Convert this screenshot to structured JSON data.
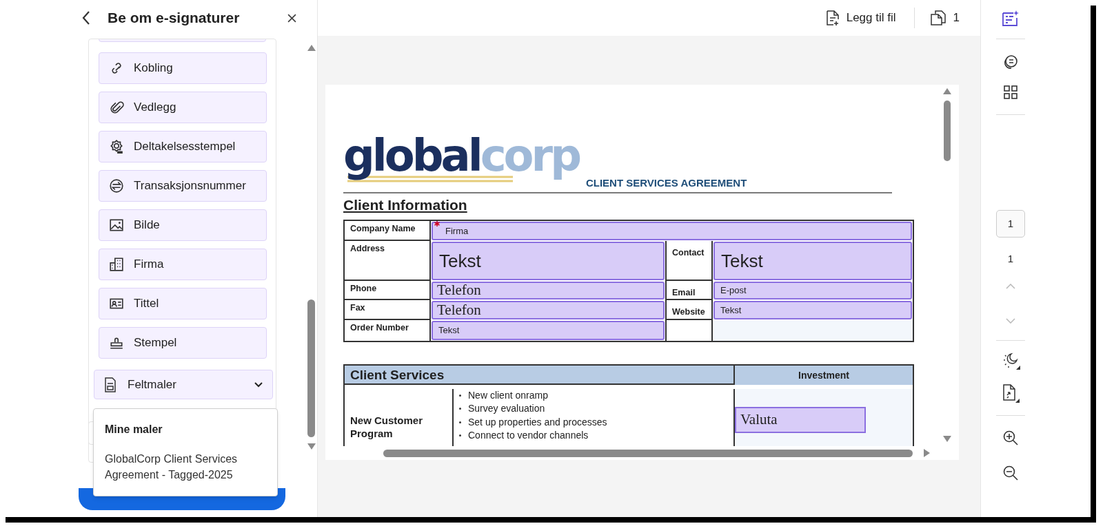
{
  "panel": {
    "title": "Be om e-signaturer",
    "items": [
      {
        "label": "Kobling"
      },
      {
        "label": "Vedlegg"
      },
      {
        "label": "Deltakelsesstempel"
      },
      {
        "label": "Transaksjonsnummer"
      },
      {
        "label": "Bilde"
      },
      {
        "label": "Firma"
      },
      {
        "label": "Tittel"
      },
      {
        "label": "Stempel"
      }
    ],
    "templates": {
      "label": "Feltmaler",
      "expanded": true
    },
    "menu": {
      "heading": "Mine maler",
      "items": [
        "GlobalCorp Client Services Agreement - Tagged-2025"
      ]
    }
  },
  "toolbar": {
    "add_file": "Legg til fil",
    "file_count": "1"
  },
  "document": {
    "logo": {
      "primary": "global",
      "secondary": "corp"
    },
    "doc_title": "CLIENT SERVICES AGREEMENT",
    "section": "Client Information",
    "company": {
      "label": "Company Name",
      "field": {
        "text": "Firma",
        "kind": "small",
        "required": true
      }
    },
    "left_rows": [
      {
        "label": "Address",
        "field": {
          "text": "Tekst",
          "kind": "large",
          "required": false
        }
      },
      {
        "label": "Phone",
        "field": {
          "text": "Telefon",
          "kind": "serif",
          "required": false
        }
      },
      {
        "label": "Fax",
        "field": {
          "text": "Telefon",
          "kind": "serif",
          "required": false
        }
      },
      {
        "label": "Order Number",
        "field": {
          "text": "Tekst",
          "kind": "small",
          "required": false
        }
      }
    ],
    "right_rows": [
      {
        "label": "Contact",
        "field": {
          "text": "Tekst",
          "kind": "large",
          "required": false
        }
      },
      {
        "label": "Email",
        "field": {
          "text": "E-post",
          "kind": "small",
          "required": false
        }
      },
      {
        "label": "Website",
        "field": {
          "text": "Tekst",
          "kind": "small",
          "required": false
        }
      }
    ],
    "services": {
      "heading": "Client Services",
      "investment": "Investment",
      "program": "New Customer Program",
      "bullets": [
        "New client onramp",
        "Survey evaluation",
        "Set up properties and processes",
        "Connect to vendor channels"
      ],
      "field": {
        "text": "Valuta",
        "kind": "serif",
        "required": false
      }
    }
  },
  "rail": {
    "page_field": "1",
    "page_count": "1"
  }
}
